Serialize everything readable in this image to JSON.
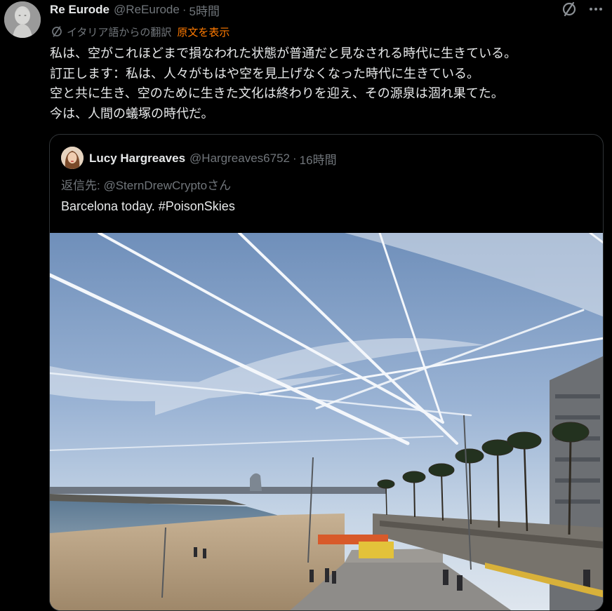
{
  "tweet": {
    "author_name": "Re Eurode",
    "author_handle": "@ReEurode",
    "separator": "·",
    "time": "5時間",
    "translation_label": "イタリア語からの翻訳",
    "show_original": "原文を表示",
    "body_lines": [
      "私は、空がこれほどまで損なわれた状態が普通だと見なされる時代に生きている。",
      "訂正します：私は、人々がもはや空を見上げなくなった時代に生きている。",
      "空と共に生き、空のために生きた文化は終わりを迎え、その源泉は涸れ果てた。",
      "今は、人間の蟻塚の時代だ。"
    ]
  },
  "quoted": {
    "author_name": "Lucy Hargreaves",
    "author_handle": "@Hargreaves6752",
    "separator": "·",
    "time": "16時間",
    "reply_to": "返信先: @SternDrewCryptoさん",
    "text": "Barcelona today. #PoisonSkies"
  },
  "colors": {
    "background": "#000000",
    "text": "#e7e9ea",
    "muted": "#71767b",
    "accent_link": "#ff7a00",
    "border": "#2f3336"
  },
  "icons": [
    "grok-slash-icon",
    "more-icon",
    "translate-icon"
  ]
}
